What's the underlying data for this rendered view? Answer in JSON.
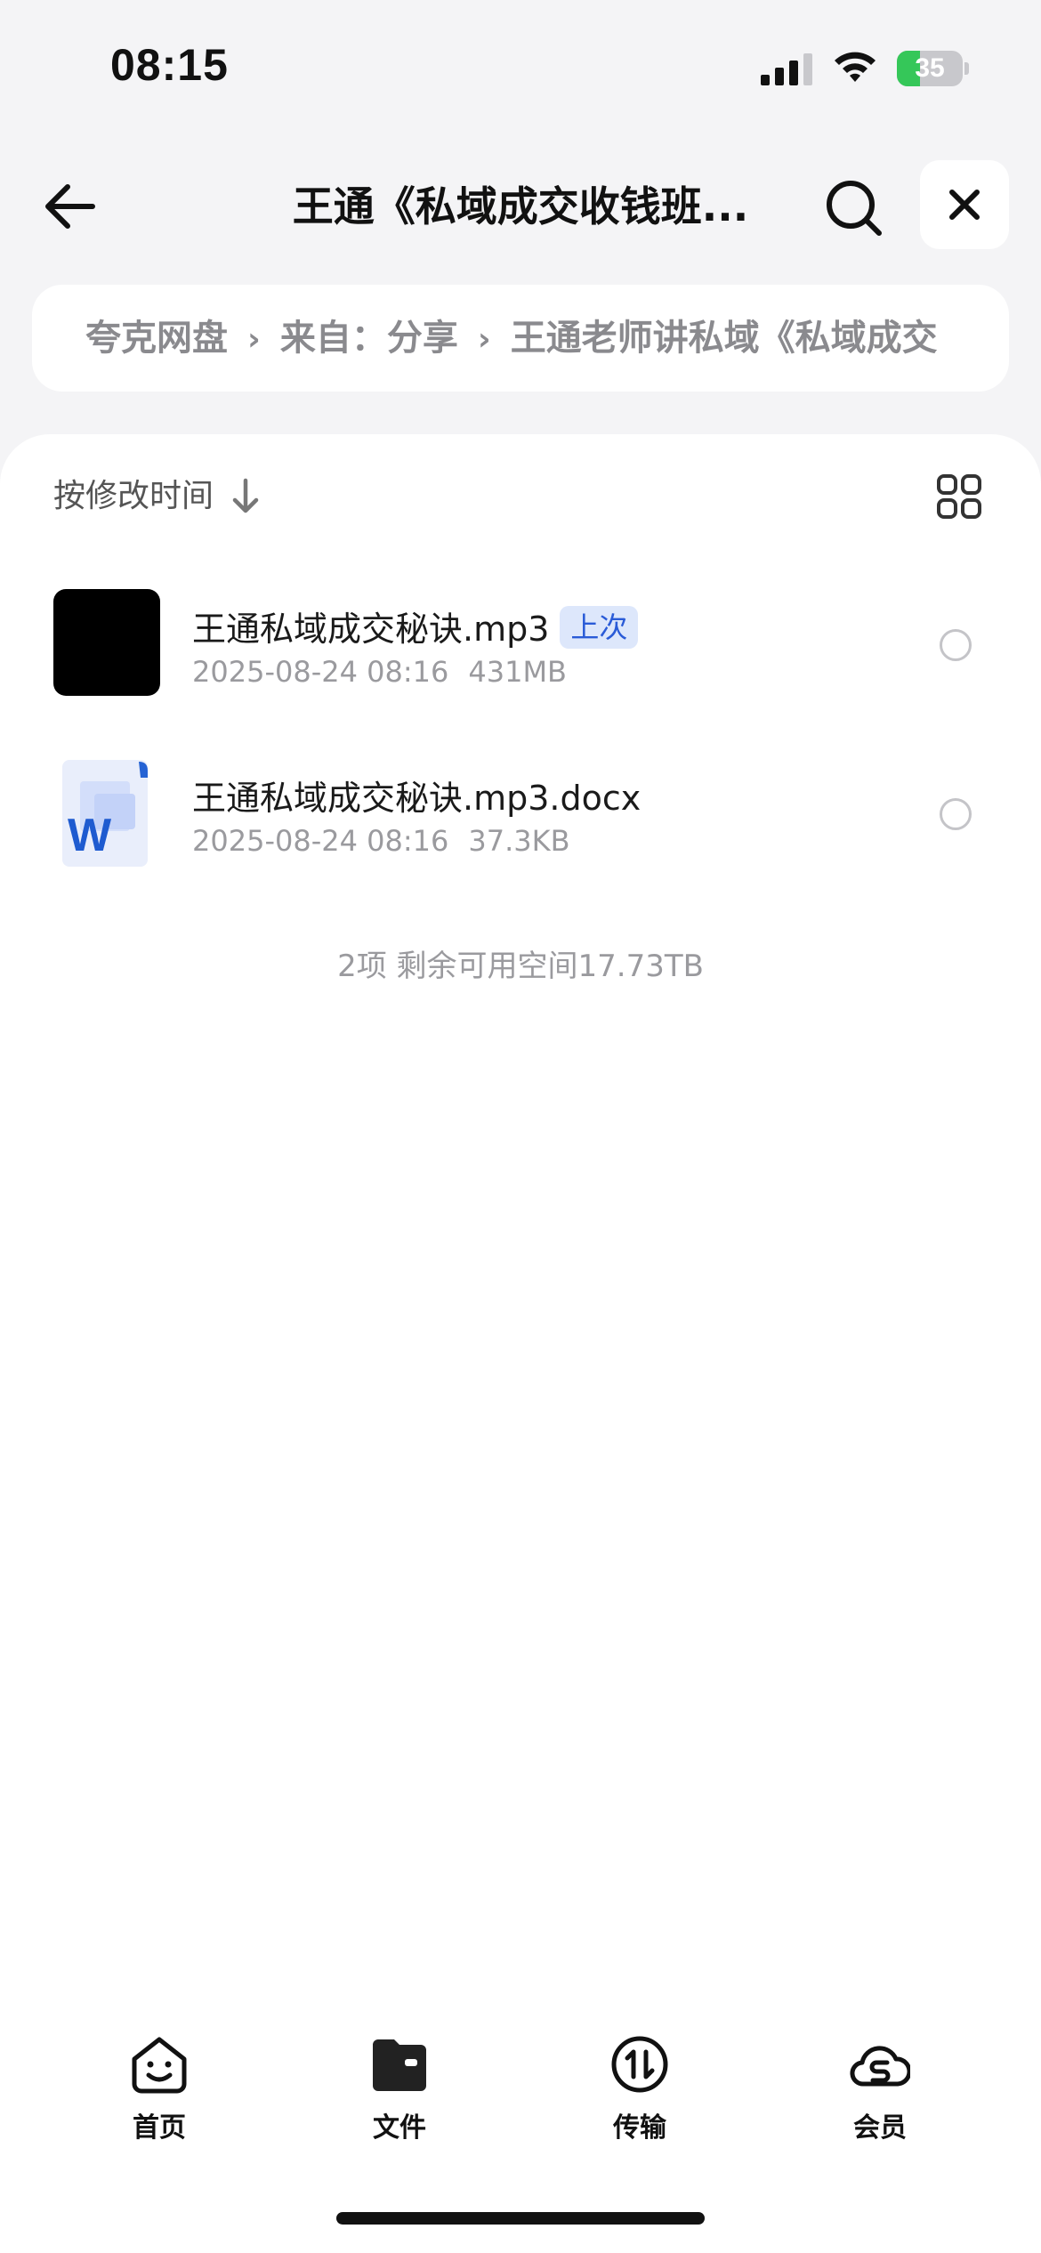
{
  "status_bar": {
    "time": "08:15",
    "battery_level": "35",
    "battery_fraction": 0.35
  },
  "nav": {
    "title": "王通《私域成交收钱班...",
    "back_icon": "arrow-left-icon",
    "search_icon": "search-icon",
    "close_icon": "close-icon"
  },
  "breadcrumb": {
    "items": [
      "夸克网盘",
      "来自：分享",
      "王通老师讲私域《私域成交"
    ]
  },
  "list": {
    "sort_label": "按修改时间",
    "sort_icon": "arrow-down-icon",
    "view_toggle_icon": "grid-view-icon",
    "files": [
      {
        "name": "王通私域成交秘诀.mp3",
        "badge": "上次",
        "date": "2025-08-24 08:16",
        "size": "431MB",
        "icon": "audio-thumbnail"
      },
      {
        "name": "王通私域成交秘诀.mp3.docx",
        "badge": "",
        "date": "2025-08-24 08:16",
        "size": "37.3KB",
        "icon": "word-doc-icon"
      }
    ],
    "summary": "2项 剩余可用空间17.73TB"
  },
  "tab_bar": {
    "tabs": [
      {
        "label": "首页",
        "icon": "smiley-home-icon"
      },
      {
        "label": "文件",
        "icon": "folder-icon"
      },
      {
        "label": "传输",
        "icon": "transfer-icon"
      },
      {
        "label": "会员",
        "icon": "cloud-member-icon"
      }
    ]
  },
  "colors": {
    "background": "#f4f4f6",
    "badge_bg": "#dde7fb",
    "badge_text": "#2a5bd7",
    "battery_green": "#35c759"
  }
}
